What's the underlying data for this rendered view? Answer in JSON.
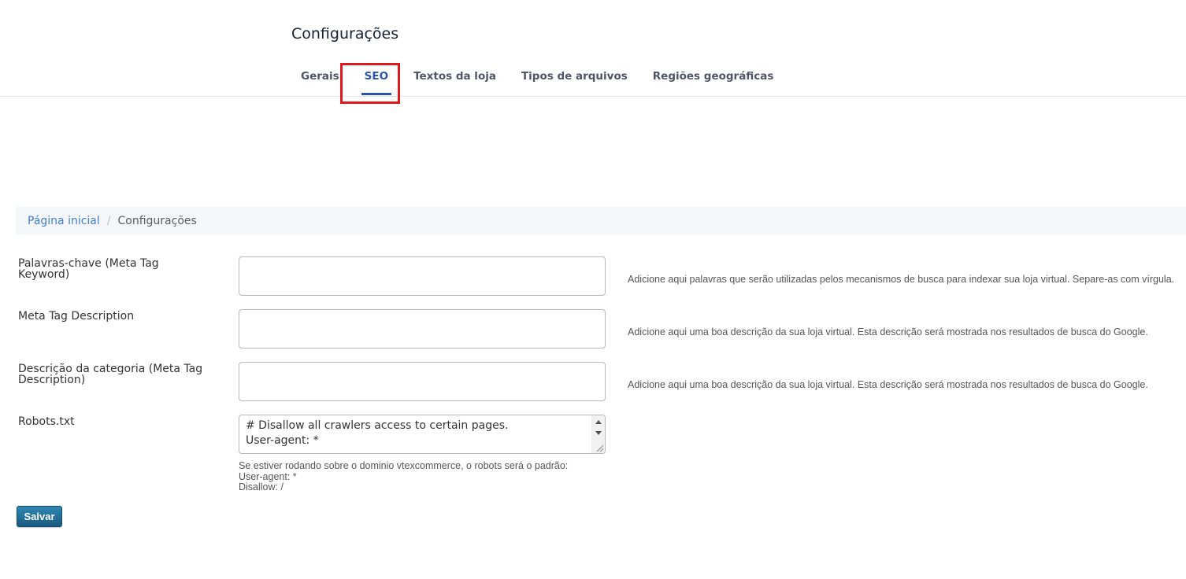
{
  "header": {
    "title": "Configurações",
    "tabs": [
      {
        "label": "Gerais"
      },
      {
        "label": "SEO",
        "active": true
      },
      {
        "label": "Textos da loja"
      },
      {
        "label": "Tipos de arquivos"
      },
      {
        "label": "Regiões geográficas"
      }
    ],
    "accent_color": "#2953b2",
    "highlight_color": "#e0191e"
  },
  "breadcrumb": {
    "home": "Página inicial",
    "separator": "/",
    "current": "Configurações"
  },
  "form": {
    "keywords": {
      "label": "Palavras-chave (Meta Tag Keyword)",
      "value": "",
      "help": "Adicione aqui palavras que serão utilizadas pelos mecanismos de busca para indexar sua loja virtual. Separe-as com vírgula."
    },
    "description": {
      "label": "Meta Tag Description",
      "value": "",
      "help": "Adicione aqui uma boa descrição da sua loja virtual. Esta descrição será mostrada nos resultados de busca do Google."
    },
    "category_description": {
      "label_line1": "Descrição da categoria (Meta Tag",
      "label_line2": "Description)",
      "value": "",
      "help": "Adicione aqui uma boa descrição da sua loja virtual. Esta descrição será mostrada nos resultados de busca do Google."
    },
    "robots": {
      "label": "Robots.txt",
      "lines": [
        "# Disallow all crawlers access to certain pages.",
        "User-agent: *"
      ],
      "note_lines": [
        "Se estiver rodando sobre o dominio vtexcommerce, o robots será o padrão:",
        "User-agent: *",
        "Disallow: /"
      ]
    },
    "save_label": "Salvar"
  }
}
